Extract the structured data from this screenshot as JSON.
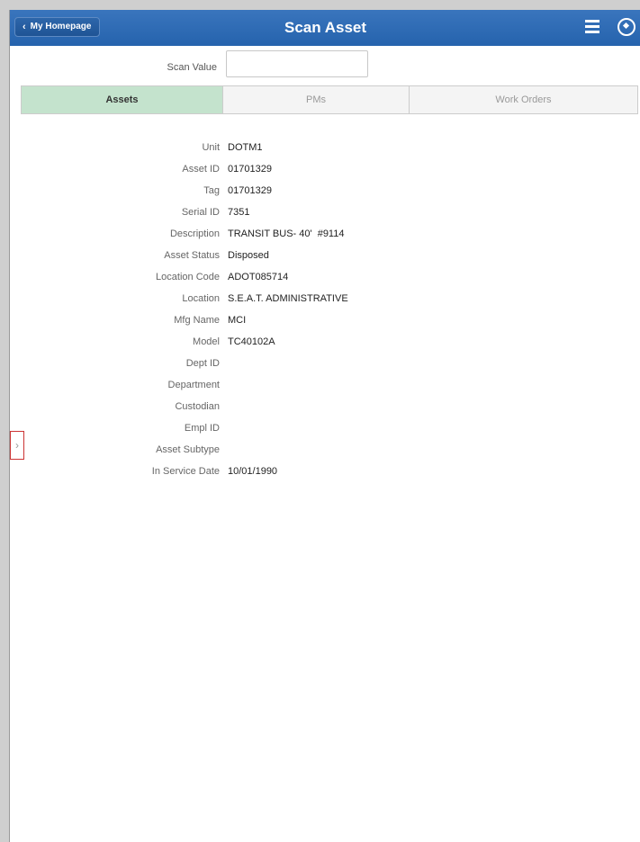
{
  "header": {
    "back_label": "My Homepage",
    "back_chevron": "‹",
    "title": "Scan Asset",
    "menu_icon": "hamburger-menu-icon",
    "nav_icon": "navbar-compass-icon"
  },
  "scan": {
    "label": "Scan Value",
    "value": ""
  },
  "tabs": [
    {
      "label": "Assets",
      "active": true
    },
    {
      "label": "PMs",
      "active": false
    },
    {
      "label": "Work Orders",
      "active": false
    }
  ],
  "fields": [
    {
      "label": "Unit",
      "value": "DOTM1"
    },
    {
      "label": "Asset ID",
      "value": "01701329"
    },
    {
      "label": "Tag",
      "value": "01701329"
    },
    {
      "label": "Serial ID",
      "value": "7351"
    },
    {
      "label": "Description",
      "value": "TRANSIT BUS- 40'  #9114"
    },
    {
      "label": "Asset Status",
      "value": "Disposed"
    },
    {
      "label": "Location Code",
      "value": "ADOT085714"
    },
    {
      "label": "Location",
      "value": "S.E.A.T. ADMINISTRATIVE"
    },
    {
      "label": "Mfg Name",
      "value": "MCI"
    },
    {
      "label": "Model",
      "value": "TC40102A"
    },
    {
      "label": "Dept ID",
      "value": ""
    },
    {
      "label": "Department",
      "value": ""
    },
    {
      "label": "Custodian",
      "value": ""
    },
    {
      "label": "Empl ID",
      "value": ""
    },
    {
      "label": "Asset Subtype",
      "value": ""
    },
    {
      "label": "In Service Date",
      "value": "10/01/1990"
    }
  ],
  "side_handle": {
    "glyph": "›"
  },
  "colors": {
    "header": "#2d6ab3",
    "active_tab": "#c4e3cd",
    "handle_border": "#cc3333"
  }
}
